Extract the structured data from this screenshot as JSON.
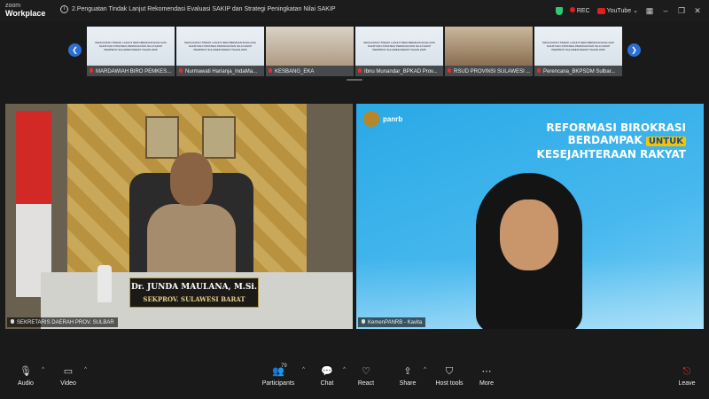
{
  "app": {
    "brand_top": "zoom",
    "brand_bottom": "Workplace"
  },
  "meeting": {
    "title": "2.Penguatan Tindak Lanjut Rekomendasi Evaluasi SAKIP dan Strategi Peningkatan Nilai SAKIP"
  },
  "titlebar": {
    "rec_label": "REC",
    "youtube_label": "YouTube"
  },
  "thumbnails": [
    {
      "name": "MARDAWIAH BIRO PEMKES...",
      "kind": "slide"
    },
    {
      "name": "Nurmawati Harianja_IndaMa...",
      "kind": "slide"
    },
    {
      "name": "KESBANG_EKA",
      "kind": "person"
    },
    {
      "name": "Ibnu Munandar_BPKAD Prov...",
      "kind": "slide"
    },
    {
      "name": "RSUD PROVINSI SULAWESI ...",
      "kind": "room"
    },
    {
      "name": "Perencana_BKPSDM Sulbar...",
      "kind": "slide"
    }
  ],
  "slide_thumb_text": "PENGUATAN TINDAK LANJUT REKOMENDASI EVALUASI SAKIP DAN STRATEGI PENINGKATAN NILAI SAKIP PEMPROV SULAWESI BARAT TAHUN 2025",
  "video_left": {
    "label": "SEKRETARIS DAERAH PROV. SULBAR",
    "nameplate_name": "Dr. JUNDA MAULANA, M.Si.",
    "nameplate_title": "SEKPROV. SULAWESI BARAT"
  },
  "video_right": {
    "label": "KemenPANRB - Kavita",
    "logo_text": "panrb",
    "slogan_line1": "REFORMASI BIROKRASI",
    "slogan_line2a": "BERDAMPAK",
    "slogan_line2b": "UNTUK",
    "slogan_line3": "KESEJAHTERAAN RAKYAT"
  },
  "toolbar": {
    "audio": "Audio",
    "video": "Video",
    "participants": "Participants",
    "participants_count": "79",
    "chat": "Chat",
    "react": "React",
    "share": "Share",
    "host_tools": "Host tools",
    "more": "More",
    "leave": "Leave"
  },
  "colors": {
    "accent_blue": "#2d6fd1",
    "rec_red": "#e02020",
    "leave_red": "#e33333",
    "panrb_blue": "#2aa9e6"
  }
}
